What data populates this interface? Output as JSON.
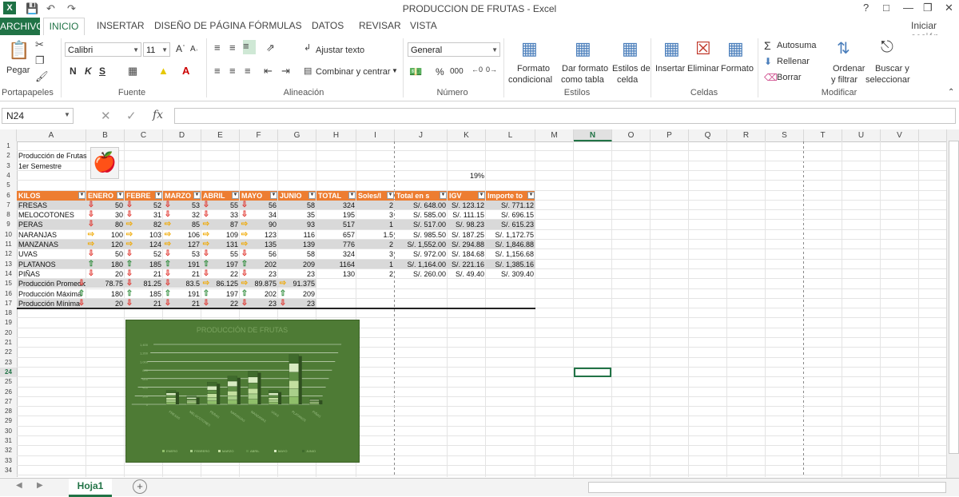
{
  "window": {
    "title": "PRODUCCION DE FRUTAS - Excel",
    "help": "?",
    "minimize": "—",
    "restore": "❐",
    "close": "✕"
  },
  "tabs": {
    "archivo": "ARCHIVO",
    "inicio": "INICIO",
    "insertar": "INSERTAR",
    "diseno": "DISEÑO DE PÁGINA",
    "formulas": "FÓRMULAS",
    "datos": "DATOS",
    "revisar": "REVISAR",
    "vista": "VISTA",
    "signin": "Iniciar sesión"
  },
  "ribbon": {
    "paste": "Pegar",
    "font_name": "Calibri",
    "font_size": "11",
    "bold": "N",
    "italic": "K",
    "underline": "S",
    "wrap_text": "Ajustar texto",
    "merge_center": "Combinar y centrar",
    "number_format": "General",
    "percent": "%",
    "thousands": "000",
    "cond_format_1": "Formato",
    "cond_format_2": "condicional",
    "table_format_1": "Dar formato",
    "table_format_2": "como tabla",
    "cell_styles_1": "Estilos de",
    "cell_styles_2": "celda",
    "insert": "Insertar",
    "delete": "Eliminar",
    "format": "Formato",
    "autosum": "Autosuma",
    "fill": "Rellenar",
    "clear": "Borrar",
    "sort_1": "Ordenar",
    "sort_2": "y filtrar",
    "find_1": "Buscar y",
    "find_2": "seleccionar",
    "groups": {
      "portapapeles": "Portapapeles",
      "fuente": "Fuente",
      "alineacion": "Alineación",
      "numero": "Número",
      "estilos": "Estilos",
      "celdas": "Celdas",
      "modificar": "Modificar"
    }
  },
  "formula_bar": {
    "name_box": "N24",
    "fx": "fx",
    "value": ""
  },
  "columns": [
    "A",
    "B",
    "C",
    "D",
    "E",
    "F",
    "G",
    "H",
    "I",
    "J",
    "K",
    "L",
    "M",
    "N",
    "O",
    "P",
    "Q",
    "R",
    "S",
    "T",
    "U",
    "V"
  ],
  "rows": [
    "1",
    "2",
    "3",
    "4",
    "5",
    "6",
    "7",
    "8",
    "9",
    "10",
    "11",
    "12",
    "13",
    "14",
    "15",
    "16",
    "17",
    "18",
    "19",
    "20",
    "21",
    "22",
    "23",
    "24",
    "25",
    "26",
    "27",
    "28",
    "29",
    "30",
    "31",
    "32",
    "33",
    "34"
  ],
  "sheet": {
    "title1": "Producción de Frutas",
    "title2": "1er Semestre",
    "igv_rate": "19%",
    "headers": [
      "KILOS",
      "ENERO",
      "FEBRE",
      "MARZO",
      "ABRIL",
      "MAYO",
      "JUNIO",
      "TOTAL",
      "Soles/l",
      "Total en s",
      "IGV",
      "Importe to"
    ],
    "data": [
      {
        "name": "FRESAS",
        "m": [
          "50",
          "52",
          "53",
          "55",
          "56",
          "58"
        ],
        "a": [
          "d",
          "d",
          "d",
          "d",
          "d"
        ],
        "total": "324",
        "price": "2",
        "tot": "S/. 648.00",
        "igv": "S/. 123.12",
        "imp": "S/. 771.12"
      },
      {
        "name": "MELOCOTONES",
        "m": [
          "30",
          "31",
          "32",
          "33",
          "34",
          "35"
        ],
        "a": [
          "d",
          "d",
          "d",
          "d",
          "d"
        ],
        "total": "195",
        "price": "3",
        "tot": "S/. 585.00",
        "igv": "S/. 111.15",
        "imp": "S/. 696.15"
      },
      {
        "name": "PERAS",
        "m": [
          "80",
          "82",
          "85",
          "87",
          "90",
          "93"
        ],
        "a": [
          "d",
          "s",
          "s",
          "s",
          "s"
        ],
        "total": "517",
        "price": "1",
        "tot": "S/. 517.00",
        "igv": "S/. 98.23",
        "imp": "S/. 615.23"
      },
      {
        "name": "NARANJAS",
        "m": [
          "100",
          "103",
          "106",
          "109",
          "123",
          "116"
        ],
        "a": [
          "s",
          "s",
          "s",
          "s",
          "s"
        ],
        "total": "657",
        "price": "1.5",
        "tot": "S/. 985.50",
        "igv": "S/. 187.25",
        "imp": "S/. 1,172.75"
      },
      {
        "name": "MANZANAS",
        "m": [
          "120",
          "124",
          "127",
          "131",
          "135",
          "139"
        ],
        "a": [
          "s",
          "s",
          "s",
          "s",
          "s"
        ],
        "total": "776",
        "price": "2",
        "tot": "S/. 1,552.00",
        "igv": "S/. 294.88",
        "imp": "S/. 1,846.88"
      },
      {
        "name": "UVAS",
        "m": [
          "50",
          "52",
          "53",
          "55",
          "56",
          "58"
        ],
        "a": [
          "d",
          "d",
          "d",
          "d",
          "d"
        ],
        "total": "324",
        "price": "3",
        "tot": "S/. 972.00",
        "igv": "S/. 184.68",
        "imp": "S/. 1,156.68"
      },
      {
        "name": "PLATANOS",
        "m": [
          "180",
          "185",
          "191",
          "197",
          "202",
          "209"
        ],
        "a": [
          "u",
          "u",
          "u",
          "u",
          "u"
        ],
        "total": "1164",
        "price": "1",
        "tot": "S/. 1,164.00",
        "igv": "S/. 221.16",
        "imp": "S/. 1,385.16"
      },
      {
        "name": "PIÑAS",
        "m": [
          "20",
          "21",
          "21",
          "22",
          "23",
          "23"
        ],
        "a": [
          "d",
          "d",
          "d",
          "d",
          "d"
        ],
        "total": "130",
        "price": "2",
        "tot": "S/. 260.00",
        "igv": "S/. 49.40",
        "imp": "S/. 309.40"
      }
    ],
    "stats": [
      {
        "name": "Producción Promedio",
        "m": [
          "78.75",
          "81.25",
          "83.5",
          "86.125",
          "89.875",
          "91.375"
        ],
        "a": [
          "d",
          "d",
          "s",
          "s",
          "s"
        ]
      },
      {
        "name": "Producción Máxima",
        "m": [
          "180",
          "185",
          "191",
          "197",
          "202",
          "209"
        ],
        "a": [
          "u",
          "u",
          "u",
          "u",
          "u"
        ]
      },
      {
        "name": "Producción Mínima",
        "m": [
          "20",
          "21",
          "21",
          "22",
          "23",
          "23"
        ],
        "a": [
          "d",
          "d",
          "d",
          "d",
          "d"
        ]
      }
    ]
  },
  "chart_data": {
    "type": "bar",
    "title": "PRODUCCIÓN DE FRUTAS",
    "categories": [
      "FRESAS",
      "MELOCOTONES",
      "PERAS",
      "NARANJAS",
      "MANZANAS",
      "UVAS",
      "PLATANOS",
      "PIÑAS"
    ],
    "series": [
      {
        "name": "ENERO",
        "values": [
          50,
          30,
          80,
          100,
          120,
          50,
          180,
          20
        ]
      },
      {
        "name": "FEBRERO",
        "values": [
          52,
          31,
          82,
          103,
          124,
          52,
          185,
          21
        ]
      },
      {
        "name": "MARZO",
        "values": [
          53,
          32,
          85,
          106,
          127,
          53,
          191,
          21
        ]
      },
      {
        "name": "ABRIL",
        "values": [
          55,
          33,
          87,
          109,
          131,
          55,
          197,
          22
        ]
      },
      {
        "name": "MAYO",
        "values": [
          56,
          34,
          90,
          123,
          135,
          56,
          202,
          23
        ]
      },
      {
        "name": "JUNIO",
        "values": [
          58,
          35,
          93,
          116,
          139,
          58,
          209,
          23
        ]
      }
    ],
    "stacked": true,
    "ylim": [
      0,
      1400
    ],
    "yticks": [
      "0",
      "200",
      "400",
      "600",
      "800",
      "1,000",
      "1,200",
      "1,400"
    ],
    "legend": "bottom"
  },
  "sheet_tab": "Hoja1",
  "add_sheet": "+"
}
